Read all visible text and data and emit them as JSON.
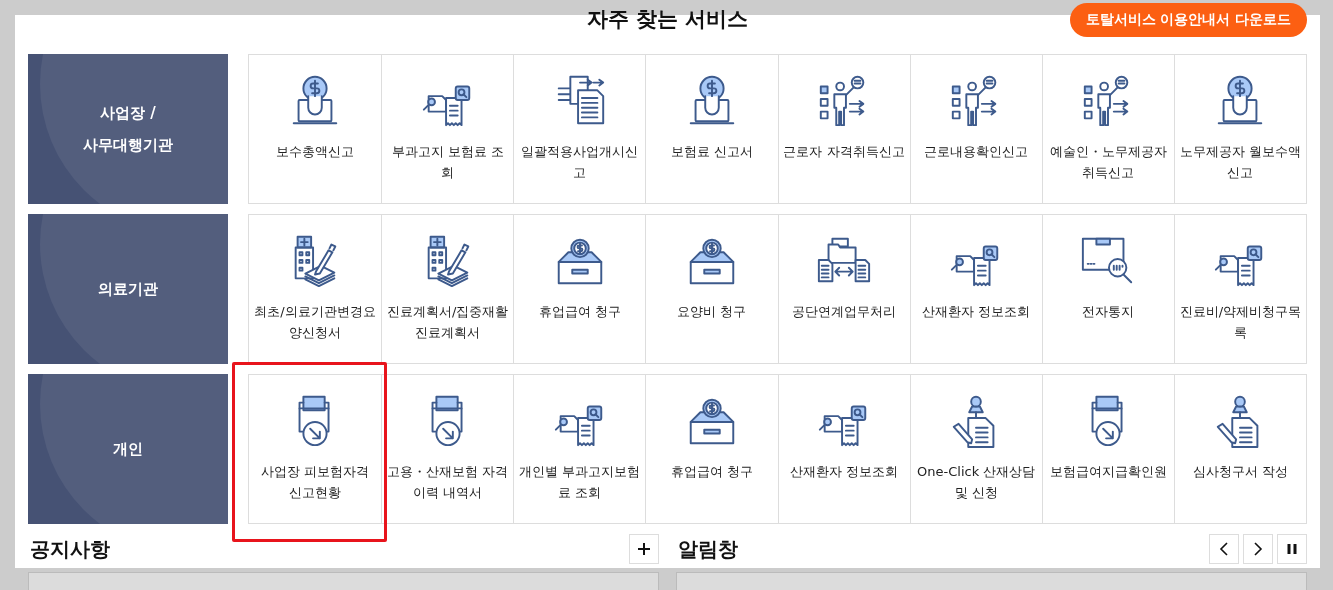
{
  "title": "자주 찾는 서비스",
  "guide_button": "토탈서비스 이용안내서 다운로드",
  "groups": [
    {
      "label": "사업장 /\n사무대행기관",
      "services": [
        {
          "label": "보수총액신고",
          "kind": "money-laptop",
          "highlighted": false
        },
        {
          "label": "부과고지 보험료 조회",
          "kind": "doc-search",
          "highlighted": false
        },
        {
          "label": "일괄적용사업개시신고",
          "kind": "docs-arrows",
          "highlighted": false
        },
        {
          "label": "보험료 신고서",
          "kind": "money-laptop",
          "highlighted": false
        },
        {
          "label": "근로자 자격취득신고",
          "kind": "person-board",
          "highlighted": false
        },
        {
          "label": "근로내용확인신고",
          "kind": "person-board",
          "highlighted": false
        },
        {
          "label": "예술인・노무제공자 취득신고",
          "kind": "person-board",
          "highlighted": false
        },
        {
          "label": "노무제공자 월보수액 신고",
          "kind": "money-laptop",
          "highlighted": false
        }
      ]
    },
    {
      "label": "의료기관",
      "services": [
        {
          "label": "최초/의료기관변경요양신청서",
          "kind": "hospital-pen",
          "highlighted": false
        },
        {
          "label": "진료계획서/집중재활진료계획서",
          "kind": "hospital-pen",
          "highlighted": false
        },
        {
          "label": "휴업급여 청구",
          "kind": "coin-box",
          "highlighted": false
        },
        {
          "label": "요양비 청구",
          "kind": "coin-box",
          "highlighted": false
        },
        {
          "label": "공단연계업무처리",
          "kind": "folder-exchange",
          "highlighted": false
        },
        {
          "label": "산재환자 정보조회",
          "kind": "doc-search",
          "highlighted": false
        },
        {
          "label": "전자통지",
          "kind": "box-search",
          "highlighted": false
        },
        {
          "label": "진료비/약제비청구목록",
          "kind": "doc-search",
          "highlighted": false
        }
      ]
    },
    {
      "label": "개인",
      "services": [
        {
          "label": "사업장 피보험자격 신고현황",
          "kind": "printer-arrow",
          "highlighted": true
        },
        {
          "label": "고용・산재보험 자격 이력 내역서",
          "kind": "printer-arrow",
          "highlighted": false
        },
        {
          "label": "개인별 부과고지보험료 조회",
          "kind": "doc-search",
          "highlighted": false
        },
        {
          "label": "휴업급여 청구",
          "kind": "coin-box",
          "highlighted": false
        },
        {
          "label": "산재환자 정보조회",
          "kind": "doc-search",
          "highlighted": false
        },
        {
          "label": "One-Click 산재상담 및 신청",
          "kind": "pin-doc",
          "highlighted": false
        },
        {
          "label": "보험급여지급확인원",
          "kind": "printer-arrow",
          "highlighted": false
        },
        {
          "label": "심사청구서 작성",
          "kind": "pin-doc",
          "highlighted": false
        }
      ]
    }
  ],
  "notice": {
    "title": "공지사항"
  },
  "alerts": {
    "title": "알림창"
  }
}
